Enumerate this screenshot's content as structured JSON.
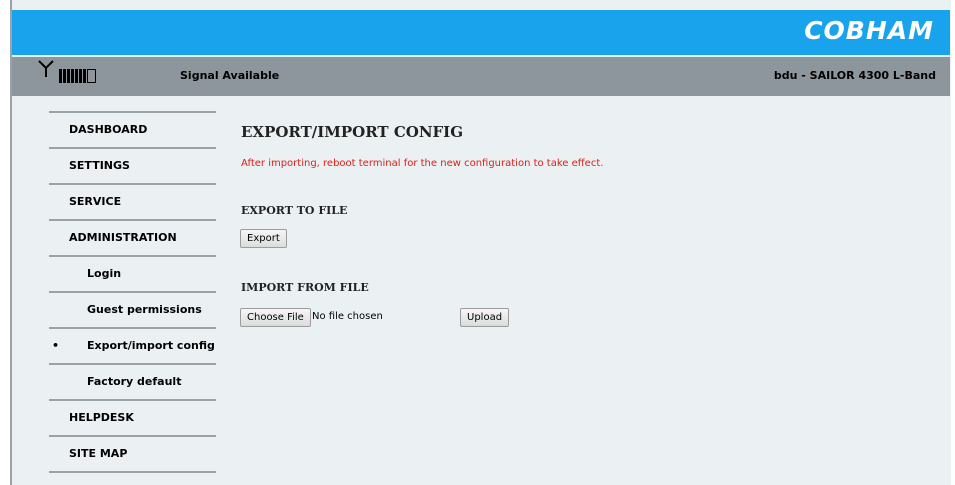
{
  "header": {
    "brand": "COBHAM"
  },
  "status_bar": {
    "signal_level": 7,
    "signal_max": 8,
    "signal_text": "Signal Available",
    "device_text": "bdu - SAILOR 4300 L-Band"
  },
  "sidebar": {
    "items": [
      {
        "label": "DASHBOARD",
        "level": "top",
        "active": false
      },
      {
        "label": "SETTINGS",
        "level": "top",
        "active": false
      },
      {
        "label": "SERVICE",
        "level": "top",
        "active": false
      },
      {
        "label": "ADMINISTRATION",
        "level": "top",
        "active": false
      },
      {
        "label": "Login",
        "level": "sub",
        "active": false
      },
      {
        "label": "Guest permissions",
        "level": "sub",
        "active": false
      },
      {
        "label": "Export/import config",
        "level": "sub",
        "active": true
      },
      {
        "label": "Factory default",
        "level": "sub",
        "active": false
      },
      {
        "label": "HELPDESK",
        "level": "top",
        "active": false
      },
      {
        "label": "SITE MAP",
        "level": "top",
        "active": false
      }
    ],
    "active_bullet": "•"
  },
  "main": {
    "title": "EXPORT/IMPORT CONFIG",
    "notice": "After importing, reboot terminal for the new configuration to take effect.",
    "export": {
      "heading": "EXPORT TO FILE",
      "button_label": "Export"
    },
    "import": {
      "heading": "IMPORT FROM FILE",
      "choose_label": "Choose File",
      "file_status": "No file chosen",
      "upload_label": "Upload"
    }
  },
  "colors": {
    "top_band": "#1aa3ed",
    "status_bar": "#8c969c",
    "page_bg": "#ebf0f2",
    "notice": "#e0201a"
  }
}
